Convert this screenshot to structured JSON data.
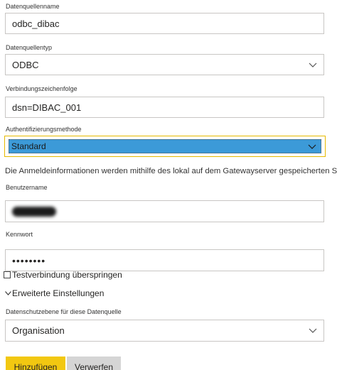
{
  "form": {
    "datasource_name": {
      "label": "Datenquellenname",
      "value": "odbc_dibac"
    },
    "datasource_type": {
      "label": "Datenquellentyp",
      "value": "ODBC",
      "icon": "chevron-down-icon"
    },
    "connection_string": {
      "label": "Verbindungszeichenfolge",
      "value": "dsn=DIBAC_001"
    },
    "auth_method": {
      "label": "Authentifizierungsmethode",
      "value": "Standard",
      "icon": "chevron-down-icon"
    },
    "info_text": "Die Anmeldeinformationen werden mithilfe des lokal auf dem Gatewayserver gespeicherten Schlüss",
    "username": {
      "label": "Benutzername"
    },
    "password": {
      "label": "Kennwort",
      "value": "••••••••"
    },
    "skip_test": {
      "label": "Testverbindung überspringen",
      "checked": false
    },
    "advanced_settings": {
      "label": "Erweiterte Einstellungen",
      "icon": "chevron-down-icon"
    },
    "privacy_level": {
      "label": "Datenschutzebene für diese Datenquelle",
      "value": "Organisation",
      "icon": "chevron-down-icon"
    }
  },
  "buttons": {
    "add_label": "Hinzufügen",
    "discard_label": "Verwerfen"
  },
  "colors": {
    "primary_button": "#f2c811",
    "secondary_button": "#d5d5d5",
    "focus_border": "#e6b900",
    "selected_highlight": "#3c9ad8"
  }
}
